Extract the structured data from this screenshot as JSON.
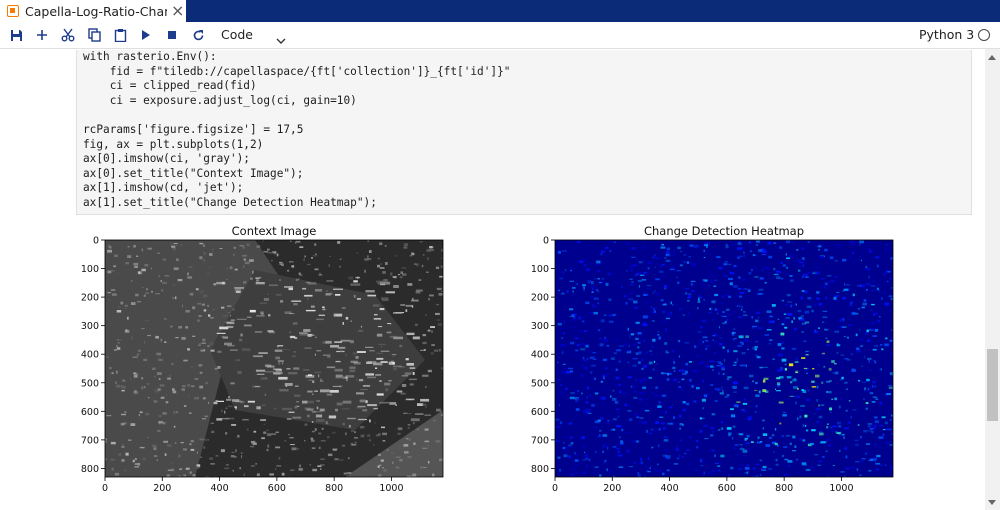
{
  "tab": {
    "title": "Capella-Log-Ratio-Change",
    "close": "×"
  },
  "toolbar": {
    "icons": [
      "save-icon",
      "add-cell-icon",
      "cut-icon",
      "copy-icon",
      "paste-icon",
      "run-icon",
      "stop-icon",
      "restart-icon"
    ],
    "cell_type": "Code",
    "kernel": "Python 3"
  },
  "code_lines": [
    "with rasterio.Env():",
    "    fid = f\"tiledb://capellaspace/{ft['collection']}_{ft['id']}\"",
    "    ci = clipped_read(fid)",
    "    ci = exposure.adjust_log(ci, gain=10)",
    "",
    "rcParams['figure.figsize'] = 17,5",
    "fig, ax = plt.subplots(1,2)",
    "ax[0].imshow(ci, 'gray');",
    "ax[0].set_title(\"Context Image\");",
    "ax[1].imshow(cd, 'jet');",
    "ax[1].set_title(\"Change Detection Heatmap\");"
  ],
  "chart_data": [
    {
      "type": "heatmap",
      "title": "Context Image",
      "colormap": "gray",
      "xlim": [
        0,
        1180
      ],
      "ylim": [
        830,
        0
      ],
      "xticks": [
        0,
        200,
        400,
        600,
        800,
        1000
      ],
      "yticks": [
        0,
        100,
        200,
        300,
        400,
        500,
        600,
        700,
        800
      ]
    },
    {
      "type": "heatmap",
      "title": "Change Detection Heatmap",
      "colormap": "jet",
      "xlim": [
        0,
        1180
      ],
      "ylim": [
        830,
        0
      ],
      "xticks": [
        0,
        200,
        400,
        600,
        800,
        1000
      ],
      "yticks": [
        0,
        100,
        200,
        300,
        400,
        500,
        600,
        700,
        800
      ]
    }
  ]
}
